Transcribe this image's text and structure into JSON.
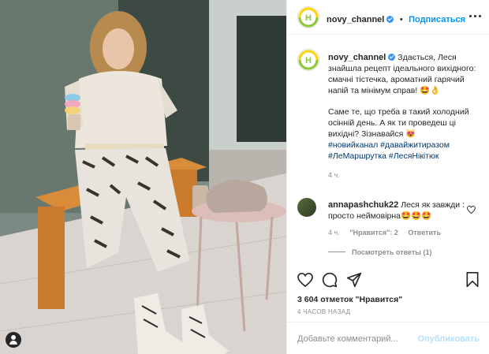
{
  "header": {
    "username": "novy_channel",
    "follow_label": "Подписаться",
    "more_icon": "more-dots-icon"
  },
  "caption": {
    "username": "novy_channel",
    "paragraph1": "Здається, Леся знайшла рецепт ідеального вихідного: смачні тістечка, ароматний гарячий напій та мінімум справ! 🤩👌",
    "paragraph2": "Саме те, що треба в такий холодний осінній день. А як ти проведеш ці вихідні? Зізнавайся 😻",
    "hashtags": "#новийканал #давайжитиразом #ЛеМаршрутка #ЛесяНікітюк",
    "time": "4 ч."
  },
  "comment": {
    "username": "annapashchuk22",
    "text": "Леся як завжди : просто неймовірна🤩🤩🤩",
    "time": "4 ч.",
    "likes": "\"Нравится\": 2",
    "reply": "Ответить",
    "view_replies": "Посмотреть ответы (1)"
  },
  "actions": {
    "like_icon": "heart-icon",
    "comment_icon": "comment-icon",
    "share_icon": "share-icon",
    "save_icon": "bookmark-icon"
  },
  "likes_text": "3 604 отметок \"Нравится\"",
  "post_time": "4 ЧАСОВ НАЗАД",
  "comment_input": {
    "placeholder": "Добавьте комментарий...",
    "publish_label": "Опубликовать"
  },
  "colors": {
    "accent": "#0095f6",
    "verified": "#3897f0",
    "muted": "#8e8e8e",
    "hashtag": "#00376b",
    "logo_green": "#8dc63f",
    "logo_yellow": "#ffd400"
  }
}
